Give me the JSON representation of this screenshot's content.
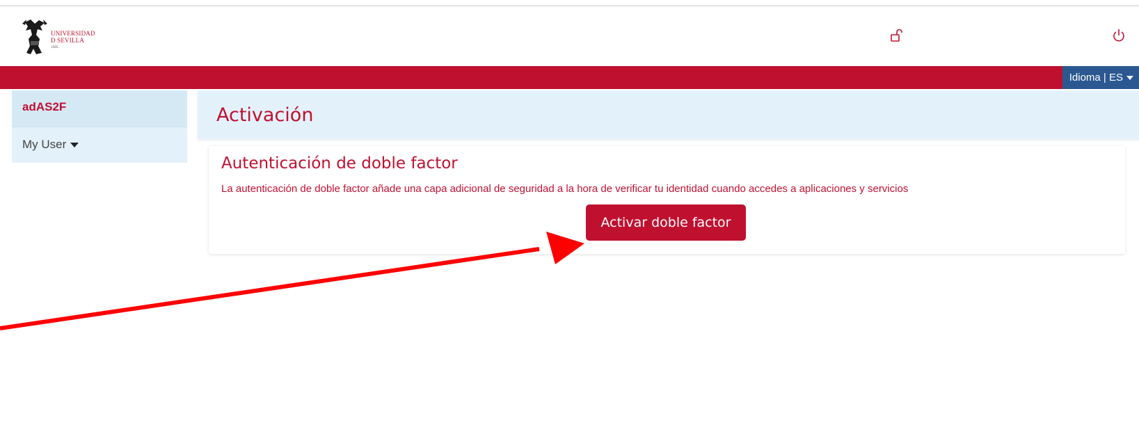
{
  "header": {
    "logo_line1": "UNIVERSIDAD",
    "logo_line2": "D SEVILLA",
    "logo_line3": "1505",
    "lock_icon": "lock-open-icon",
    "power_icon": "power-icon"
  },
  "topbar": {
    "language_label": "Idioma | ES",
    "accent_color": "#c01030",
    "lang_color": "#2b5891"
  },
  "sidebar": {
    "title": "adAS2F",
    "items": [
      {
        "label": "My User"
      }
    ]
  },
  "main": {
    "page_title": "Activación",
    "card": {
      "title": "Autenticación de doble factor",
      "description": "La autenticación de doble factor añade una capa adicional de seguridad a la hora de verificar tu identidad cuando accedes a aplicaciones y servicios",
      "button_label": "Activar doble factor"
    }
  },
  "annotation": {
    "arrow_color": "#ff0000",
    "arrow_icon": "arrow-annotation"
  }
}
